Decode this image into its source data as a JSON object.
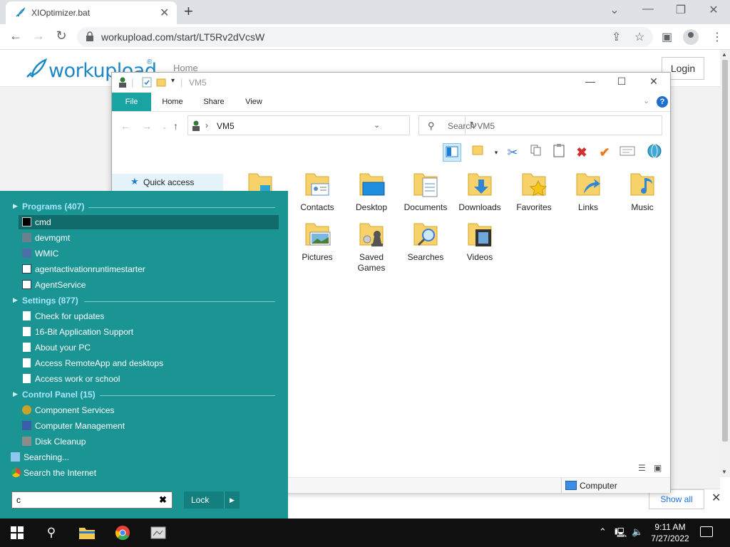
{
  "browser": {
    "tab_title": "XIOptimizer.bat",
    "tab_close": "✕",
    "new_tab": "+",
    "url": "workupload.com/start/LT5Rv2dVcsW",
    "window_controls": [
      "⌄",
      "—",
      "❐",
      "✕"
    ]
  },
  "site": {
    "logo_text": "workupload",
    "reg": "®",
    "nav_home": "Home",
    "login": "Login",
    "show_all": "Show all",
    "close_bar": "✕"
  },
  "explorer": {
    "title": "VM5",
    "tabs": [
      "File",
      "Home",
      "Share",
      "View"
    ],
    "help": "?",
    "address": "VM5",
    "search_placeholder": "Search VM5",
    "quick_access": "Quick access",
    "items": [
      {
        "label": "Contacts",
        "icon": "contacts-folder-icon"
      },
      {
        "label": "Desktop",
        "icon": "desktop-folder-icon"
      },
      {
        "label": "Documents",
        "icon": "documents-folder-icon"
      },
      {
        "label": "Downloads",
        "icon": "downloads-folder-icon"
      },
      {
        "label": "Favorites",
        "icon": "favorites-folder-icon"
      },
      {
        "label": "Links",
        "icon": "links-folder-icon"
      },
      {
        "label": "Music",
        "icon": "music-folder-icon"
      },
      {
        "label": "Pictures",
        "icon": "pictures-folder-icon"
      },
      {
        "label": "Saved Games",
        "icon": "saved-games-folder-icon"
      },
      {
        "label": "Searches",
        "icon": "searches-folder-icon"
      },
      {
        "label": "Videos",
        "icon": "videos-folder-icon"
      }
    ],
    "status": "Computer"
  },
  "start": {
    "groups": {
      "programs": "Programs (407)",
      "settings": "Settings (877)",
      "control_panel": "Control Panel (15)"
    },
    "programs": [
      "cmd",
      "devmgmt",
      "WMIC",
      "agentactivationruntimestarter",
      "AgentService"
    ],
    "settings": [
      "Check for updates",
      "16-Bit Application Support",
      "About your PC",
      "Access RemoteApp and desktops",
      "Access work or school"
    ],
    "control_panel": [
      "Component Services",
      "Computer Management",
      "Disk Cleanup"
    ],
    "searching": "Searching...",
    "search_internet": "Search the Internet",
    "search_value": "c",
    "clear": "✖",
    "lock": "Lock"
  },
  "taskbar": {
    "time": "9:11 AM",
    "date": "7/27/2022"
  },
  "colors": {
    "start_bg": "#1b9494",
    "file_tab": "#19a3a3",
    "logo_blue": "#1e88c7"
  }
}
